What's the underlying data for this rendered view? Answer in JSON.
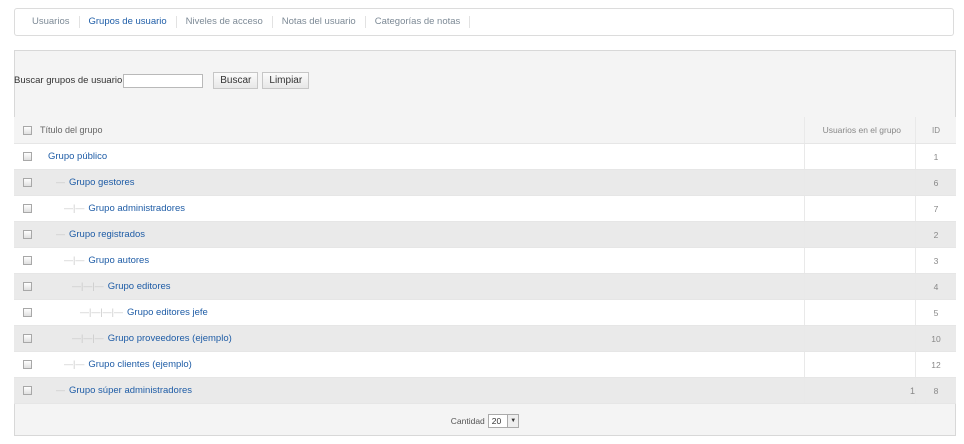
{
  "tabs": [
    {
      "label": "Usuarios"
    },
    {
      "label": "Grupos de usuario"
    },
    {
      "label": "Niveles de acceso"
    },
    {
      "label": "Notas del usuario"
    },
    {
      "label": "Categorías de notas"
    }
  ],
  "search": {
    "label": "Buscar grupos de usuario",
    "value": "",
    "search_button": "Buscar",
    "clear_button": "Limpiar"
  },
  "table": {
    "header_title": "Título del grupo",
    "header_count": "Usuarios en el grupo",
    "header_id": "ID",
    "rows": [
      {
        "prefix": "",
        "title": "Grupo público",
        "count": "",
        "id": "1"
      },
      {
        "prefix": "—",
        "title": "Grupo gestores",
        "count": "",
        "id": "6"
      },
      {
        "prefix": "—|—",
        "title": "Grupo administradores",
        "count": "",
        "id": "7"
      },
      {
        "prefix": "—",
        "title": "Grupo registrados",
        "count": "",
        "id": "2"
      },
      {
        "prefix": "—|—",
        "title": "Grupo autores",
        "count": "",
        "id": "3"
      },
      {
        "prefix": "—|—|—",
        "title": "Grupo editores",
        "count": "",
        "id": "4"
      },
      {
        "prefix": "—|—|—|—",
        "title": "Grupo editores jefe",
        "count": "",
        "id": "5"
      },
      {
        "prefix": "—|—|—",
        "title": "Grupo proveedores (ejemplo)",
        "count": "",
        "id": "10"
      },
      {
        "prefix": "—|—",
        "title": "Grupo clientes (ejemplo)",
        "count": "",
        "id": "12"
      },
      {
        "prefix": "—",
        "title": "Grupo súper administradores",
        "count": "1",
        "id": "8"
      }
    ]
  },
  "footer": {
    "label": "Cantidad",
    "selected": "20"
  }
}
